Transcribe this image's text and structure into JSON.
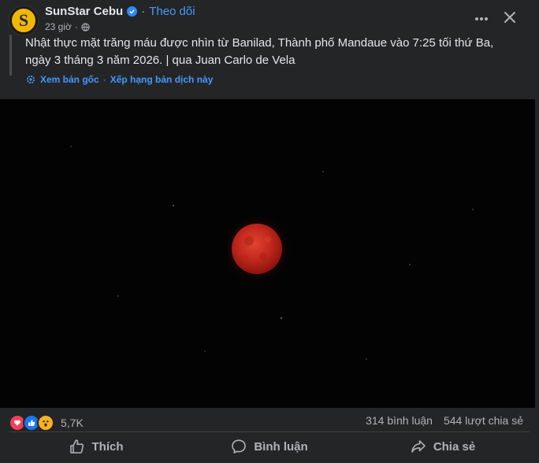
{
  "header": {
    "page_name": "SunStar Cebu",
    "follow_label": "Theo dõi",
    "time": "23 giờ",
    "separator": "·"
  },
  "post": {
    "caption": "Nhật thực mặt trăng máu được nhìn từ Banilad, Thành phố Mandaue vào 7:25 tối thứ Ba, ngày 3 tháng 3 năm 2026. | qua Juan Carlo de Vela",
    "see_original": "Xem bản gốc",
    "rate_translation": "Xếp hạng bản dịch này"
  },
  "stats": {
    "reaction_count": "5,7K",
    "comments": "314 bình luận",
    "shares": "544 lượt chia sẻ"
  },
  "actions": {
    "like": "Thích",
    "comment": "Bình luận",
    "share": "Chia sẻ"
  },
  "icons": {
    "avatar_letter": "S",
    "reactions": [
      "love-icon",
      "like-icon",
      "wow-icon"
    ]
  },
  "colors": {
    "background": "#242526",
    "link": "#4599ff",
    "moon": "#c2271c",
    "verified": "#2d88ff"
  }
}
